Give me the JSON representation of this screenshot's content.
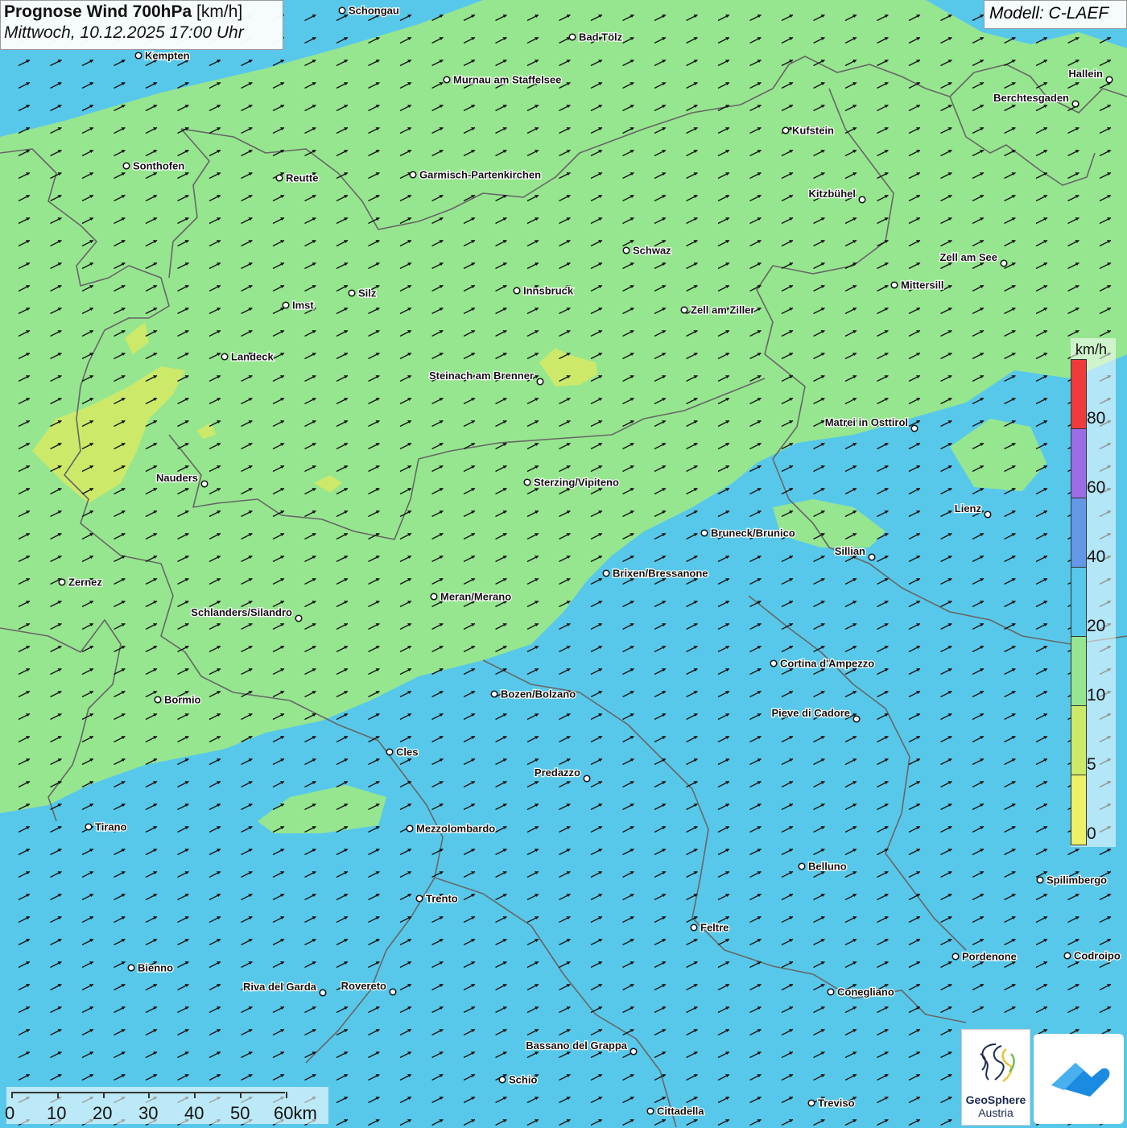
{
  "header": {
    "title_bold": "Prognose Wind 700hPa",
    "title_unit": "[km/h]",
    "datetime": "Mittwoch, 10.12.2025 17:00 Uhr",
    "model": "Modell: C-LAEF"
  },
  "colors": {
    "wind_0_5": "#eef06a",
    "wind_5_10": "#cde96a",
    "wind_10_20": "#96e68f",
    "wind_20_40": "#58c8ea",
    "wind_40_60": "#6497e6",
    "wind_60_80": "#9b6ce6",
    "wind_80_plus": "#ef3b3b",
    "borders": "#666666",
    "arrows": "#111111"
  },
  "legend": {
    "unit": "km/h",
    "ticks": [
      "80",
      "60",
      "40",
      "20",
      "10",
      "5",
      "0"
    ]
  },
  "wind": {
    "dominant_direction": "from south-west (arrows point north-east)",
    "fields": [
      {
        "region": "north (Bavaria, North Tyrol, Salzburg)",
        "range_kmh": "10-20"
      },
      {
        "region": "south (South Tyrol, Trentino, Veneto)",
        "range_kmh": "20-40"
      },
      {
        "region": "patches near Landeck and Nauders",
        "range_kmh": "5-10"
      }
    ]
  },
  "cities": [
    {
      "name": "Schongau"
    },
    {
      "name": "Bad Tölz"
    },
    {
      "name": "Kempten"
    },
    {
      "name": "Murnau am Staffelsee"
    },
    {
      "name": "Hallein"
    },
    {
      "name": "Berchtesgaden"
    },
    {
      "name": "Kufstein"
    },
    {
      "name": "Sonthofen"
    },
    {
      "name": "Reutte"
    },
    {
      "name": "Garmisch-Partenkirchen"
    },
    {
      "name": "Kitzbühel"
    },
    {
      "name": "Schwaz"
    },
    {
      "name": "Zell am See"
    },
    {
      "name": "Mittersill"
    },
    {
      "name": "Innsbruck"
    },
    {
      "name": "Silz"
    },
    {
      "name": "Imst"
    },
    {
      "name": "Zell am Ziller"
    },
    {
      "name": "Landeck"
    },
    {
      "name": "Steinach am Brenner"
    },
    {
      "name": "Matrei in Osttirol"
    },
    {
      "name": "Nauders"
    },
    {
      "name": "Sterzing/Vipiteno"
    },
    {
      "name": "Lienz"
    },
    {
      "name": "Bruneck/Brunico"
    },
    {
      "name": "Sillian"
    },
    {
      "name": "Zernez"
    },
    {
      "name": "Brixen/Bressanone"
    },
    {
      "name": "Meran/Merano"
    },
    {
      "name": "Schlanders/Silandro"
    },
    {
      "name": "Cortina d'Ampezzo"
    },
    {
      "name": "Bozen/Bolzano"
    },
    {
      "name": "Bormio"
    },
    {
      "name": "Pieve di Cadore"
    },
    {
      "name": "Cles"
    },
    {
      "name": "Predazzo"
    },
    {
      "name": "Tirano"
    },
    {
      "name": "Mezzolombardo"
    },
    {
      "name": "Belluno"
    },
    {
      "name": "Spilimbergo"
    },
    {
      "name": "Trento"
    },
    {
      "name": "Feltre"
    },
    {
      "name": "Bienno"
    },
    {
      "name": "Pordenone"
    },
    {
      "name": "Codroipo"
    },
    {
      "name": "Riva del Garda"
    },
    {
      "name": "Rovereto"
    },
    {
      "name": "Conegliano"
    },
    {
      "name": "Bassano del Grappa"
    },
    {
      "name": "Schio"
    },
    {
      "name": "Treviso"
    },
    {
      "name": "Cittadella"
    }
  ],
  "scale_bar": {
    "labels": [
      "0",
      "10",
      "20",
      "30",
      "40",
      "50",
      "60km"
    ]
  },
  "logo": {
    "name": "GeoSphere",
    "sub": "Austria"
  }
}
